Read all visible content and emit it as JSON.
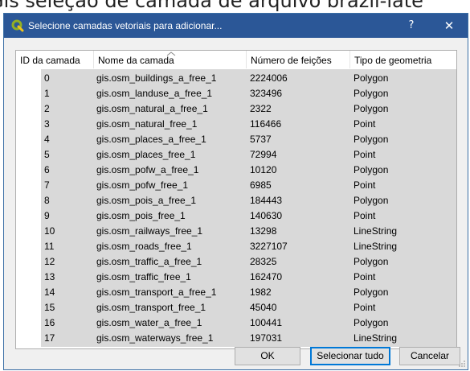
{
  "background_caption": "Gis seleção de camada de arquivo brazil-late",
  "dialog": {
    "title": "Selecione camadas vetoriais para adicionar...",
    "help_label": "?",
    "close_label": "✕"
  },
  "table": {
    "columns": [
      "ID da camada",
      "Nome da camada",
      "Número de feições",
      "Tipo de geometria"
    ],
    "rows": [
      [
        "0",
        "gis.osm_buildings_a_free_1",
        "2224006",
        "Polygon"
      ],
      [
        "1",
        "gis.osm_landuse_a_free_1",
        "323496",
        "Polygon"
      ],
      [
        "2",
        "gis.osm_natural_a_free_1",
        "2322",
        "Polygon"
      ],
      [
        "3",
        "gis.osm_natural_free_1",
        "116466",
        "Point"
      ],
      [
        "4",
        "gis.osm_places_a_free_1",
        "5737",
        "Polygon"
      ],
      [
        "5",
        "gis.osm_places_free_1",
        "72994",
        "Point"
      ],
      [
        "6",
        "gis.osm_pofw_a_free_1",
        "10120",
        "Polygon"
      ],
      [
        "7",
        "gis.osm_pofw_free_1",
        "6985",
        "Point"
      ],
      [
        "8",
        "gis.osm_pois_a_free_1",
        "184443",
        "Polygon"
      ],
      [
        "9",
        "gis.osm_pois_free_1",
        "140630",
        "Point"
      ],
      [
        "10",
        "gis.osm_railways_free_1",
        "13298",
        "LineString"
      ],
      [
        "11",
        "gis.osm_roads_free_1",
        "3227107",
        "LineString"
      ],
      [
        "12",
        "gis.osm_traffic_a_free_1",
        "28325",
        "Polygon"
      ],
      [
        "13",
        "gis.osm_traffic_free_1",
        "162470",
        "Point"
      ],
      [
        "14",
        "gis.osm_transport_a_free_1",
        "1982",
        "Polygon"
      ],
      [
        "15",
        "gis.osm_transport_free_1",
        "45040",
        "Point"
      ],
      [
        "16",
        "gis.osm_water_a_free_1",
        "100441",
        "Polygon"
      ],
      [
        "17",
        "gis.osm_waterways_free_1",
        "197031",
        "LineString"
      ]
    ]
  },
  "buttons": {
    "ok": "OK",
    "select_all": "Selecionar tudo",
    "cancel": "Cancelar"
  },
  "colors": {
    "titlebar": "#2b5797",
    "selection": "#d9d9d9",
    "default_button_border": "#0078d7",
    "qgis_icon": "#93b023"
  }
}
